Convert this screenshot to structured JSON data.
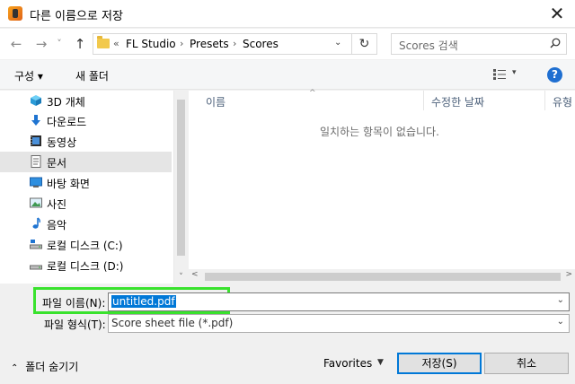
{
  "window": {
    "title": "다른 이름으로 저장",
    "close_glyph": "✕"
  },
  "nav": {
    "back_glyph": "←",
    "forward_glyph": "→",
    "recent_glyph": "˅",
    "up_glyph": "↑",
    "breadcrumb_prefix": "«",
    "breadcrumb": [
      "FL Studio",
      "Presets",
      "Scores"
    ],
    "breadcrumb_sep": "›",
    "refresh_glyph": "↻",
    "search_placeholder": "Scores 검색"
  },
  "toolbar": {
    "organize_label": "구성 ▾",
    "new_folder_label": "새 폴더",
    "help_glyph": "?"
  },
  "sidebar": {
    "items": [
      {
        "label": "3D 개체",
        "icon": "3d-objects-icon"
      },
      {
        "label": "다운로드",
        "icon": "download-icon"
      },
      {
        "label": "동영상",
        "icon": "video-icon"
      },
      {
        "label": "문서",
        "icon": "document-icon",
        "selected": true
      },
      {
        "label": "바탕 화면",
        "icon": "desktop-icon"
      },
      {
        "label": "사진",
        "icon": "pictures-icon"
      },
      {
        "label": "음악",
        "icon": "music-icon"
      },
      {
        "label": "로컬 디스크 (C:)",
        "icon": "drive-icon"
      },
      {
        "label": "로컬 디스크 (D:)",
        "icon": "drive-icon"
      }
    ]
  },
  "file_list": {
    "columns": [
      "이름",
      "수정한 날짜",
      "유형"
    ],
    "empty_message": "일치하는 항목이 없습니다."
  },
  "form": {
    "filename_label": "파일 이름(N):",
    "filename_value": "untitled.pdf",
    "filetype_label": "파일 형식(T):",
    "filetype_value": "Score sheet file (*.pdf)"
  },
  "footer": {
    "hide_folders_label": "폴더 숨기기",
    "favorites_label": "Favorites",
    "save_label": "저장(S)",
    "cancel_label": "취소"
  },
  "colors": {
    "highlight": "#39e22d",
    "selection": "#0078d7",
    "help": "#1f6fd1"
  }
}
